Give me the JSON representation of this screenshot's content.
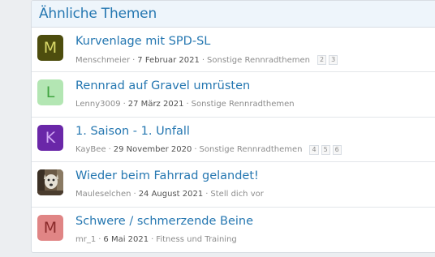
{
  "section": {
    "title": "Ähnliche Themen"
  },
  "threads": [
    {
      "avatar_letter": "M",
      "avatar_bg": "#4d4d0e",
      "avatar_fg": "#d8d868",
      "title": "Kurvenlage mit SPD-SL",
      "author": "Menschmeier",
      "date": "7 Februar 2021",
      "forum": "Sonstige Rennradthemen",
      "pages": [
        "2",
        "3"
      ]
    },
    {
      "avatar_letter": "L",
      "avatar_bg": "#b3e6b3",
      "avatar_fg": "#3fa33f",
      "title": "Rennrad auf Gravel umrüsten",
      "author": "Lenny3009",
      "date": "27 März 2021",
      "forum": "Sonstige Rennradthemen",
      "pages": []
    },
    {
      "avatar_letter": "K",
      "avatar_bg": "#6a27a8",
      "avatar_fg": "#d2a8f5",
      "title": "1. Saison - 1. Unfall",
      "author": "KayBee",
      "date": "29 November 2020",
      "forum": "Sonstige Rennradthemen",
      "pages": [
        "4",
        "5",
        "6"
      ]
    },
    {
      "avatar_letter": "",
      "avatar_icon": "dog-photo",
      "title": "Wieder beim Fahrrad gelandet!",
      "author": "Mauleselchen",
      "date": "24 August 2021",
      "forum": "Stell dich vor",
      "pages": []
    },
    {
      "avatar_letter": "M",
      "avatar_bg": "#e08585",
      "avatar_fg": "#8a2a2a",
      "title": "Schwere / schmerzende Beine",
      "author": "mr_1",
      "date": "6 Mai 2021",
      "forum": "Fitness und Training",
      "pages": []
    }
  ]
}
